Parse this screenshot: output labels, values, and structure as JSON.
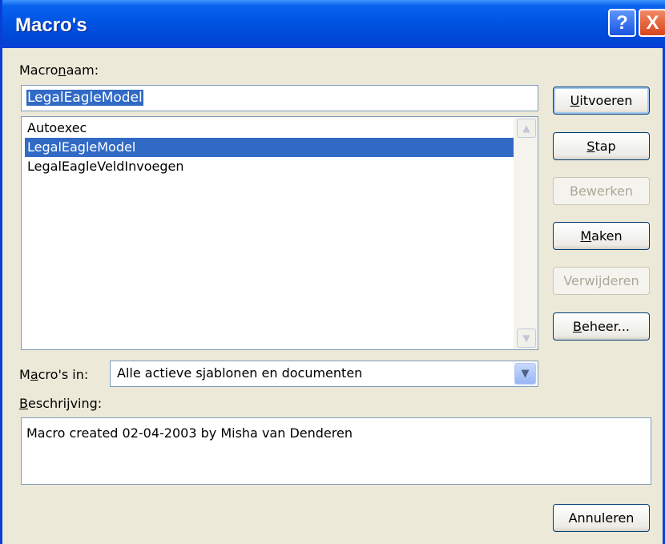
{
  "window": {
    "title": "Macro's",
    "help_button": "?",
    "close_button": "X"
  },
  "macro_name": {
    "label_pre": "Macro",
    "label_key": "n",
    "label_post": "aam:",
    "value": "LegalEagleModel"
  },
  "macro_list": {
    "items": [
      "Autoexec",
      "LegalEagleModel",
      "LegalEagleVeldInvoegen"
    ],
    "selected": "LegalEagleModel",
    "scroll_up": "▲",
    "scroll_down": "▼"
  },
  "buttons": {
    "uitvoeren": {
      "key": "U",
      "rest": "itvoeren"
    },
    "stap": {
      "key": "S",
      "rest": "tap"
    },
    "bewerken": {
      "label": "Bewerken"
    },
    "maken": {
      "key": "M",
      "rest": "aken"
    },
    "verwijderen": {
      "label": "Verwijderen"
    },
    "beheer": {
      "key": "B",
      "rest": "eheer..."
    },
    "annuleren": {
      "label": "Annuleren"
    }
  },
  "macros_in": {
    "label_pre": "M",
    "label_key": "a",
    "label_post": "cro's in:",
    "value": "Alle actieve sjablonen en documenten",
    "dropdown_icon": "▼"
  },
  "description": {
    "label_key": "B",
    "label_rest": "eschrijving:",
    "value": "Macro created 02-04-2003 by Misha van Denderen"
  },
  "colors": {
    "title_bar": "#0054e3",
    "selection": "#316ac5",
    "dialog_bg": "#ece9d8"
  }
}
